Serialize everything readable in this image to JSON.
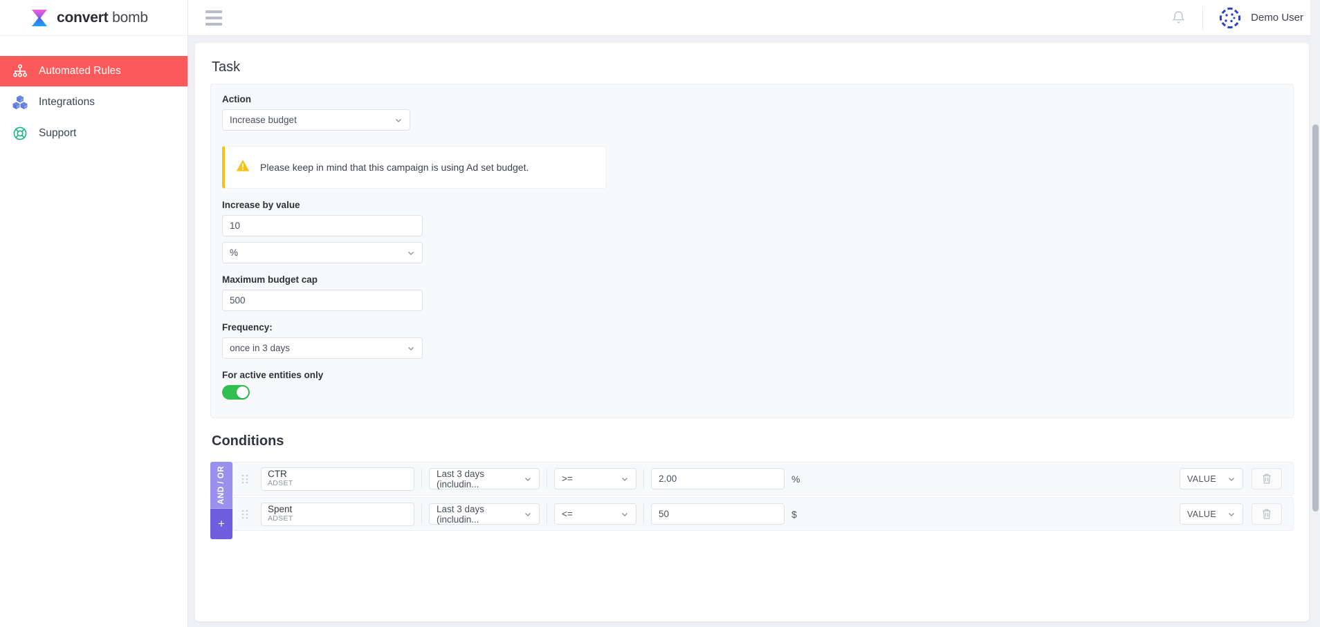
{
  "brand": {
    "name_bold": "convert",
    "name_light": "bomb",
    "logo_icon": "hourglass-logo"
  },
  "sidebar": {
    "items": [
      {
        "label": "Automated Rules",
        "icon": "sitemap-icon",
        "active": true
      },
      {
        "label": "Integrations",
        "icon": "cubes-icon",
        "active": false
      },
      {
        "label": "Support",
        "icon": "lifering-icon",
        "active": false
      }
    ]
  },
  "topbar": {
    "menu_icon": "hamburger-icon",
    "notifications_icon": "bell-icon",
    "avatar_icon": "user-avatar",
    "user_name": "Demo User"
  },
  "task": {
    "title": "Task",
    "action_label": "Action",
    "action_value": "Increase budget",
    "warning": {
      "icon": "warning-triangle-icon",
      "text": "Please keep in mind that this campaign is using Ad set budget.",
      "accent_color": "#f4c317"
    },
    "increase_label": "Increase by value",
    "increase_value": "10",
    "increase_unit": "%",
    "budget_cap_label": "Maximum budget cap",
    "budget_cap_value": "500",
    "frequency_label": "Frequency:",
    "frequency_value": "once in 3 days",
    "active_only_label": "For active entities only",
    "active_only_on": true,
    "toggle_on_color": "#2fc050"
  },
  "conditions": {
    "title": "Conditions",
    "andor_label": "AND / OR",
    "add_label": "+",
    "andor_color": "#9a90ee",
    "add_color": "#6f5fe0",
    "rows": [
      {
        "grip_icon": "drag-handle-icon",
        "metric": "CTR",
        "level": "ADSET",
        "date_range": "Last 3 days (includin...",
        "operator": ">=",
        "value": "2.00",
        "unit": "%",
        "value_type": "VALUE",
        "delete_icon": "trash-icon"
      },
      {
        "grip_icon": "drag-handle-icon",
        "metric": "Spent",
        "level": "ADSET",
        "date_range": "Last 3 days (includin...",
        "operator": "<=",
        "value": "50",
        "unit": "$",
        "value_type": "VALUE",
        "delete_icon": "trash-icon"
      }
    ]
  }
}
